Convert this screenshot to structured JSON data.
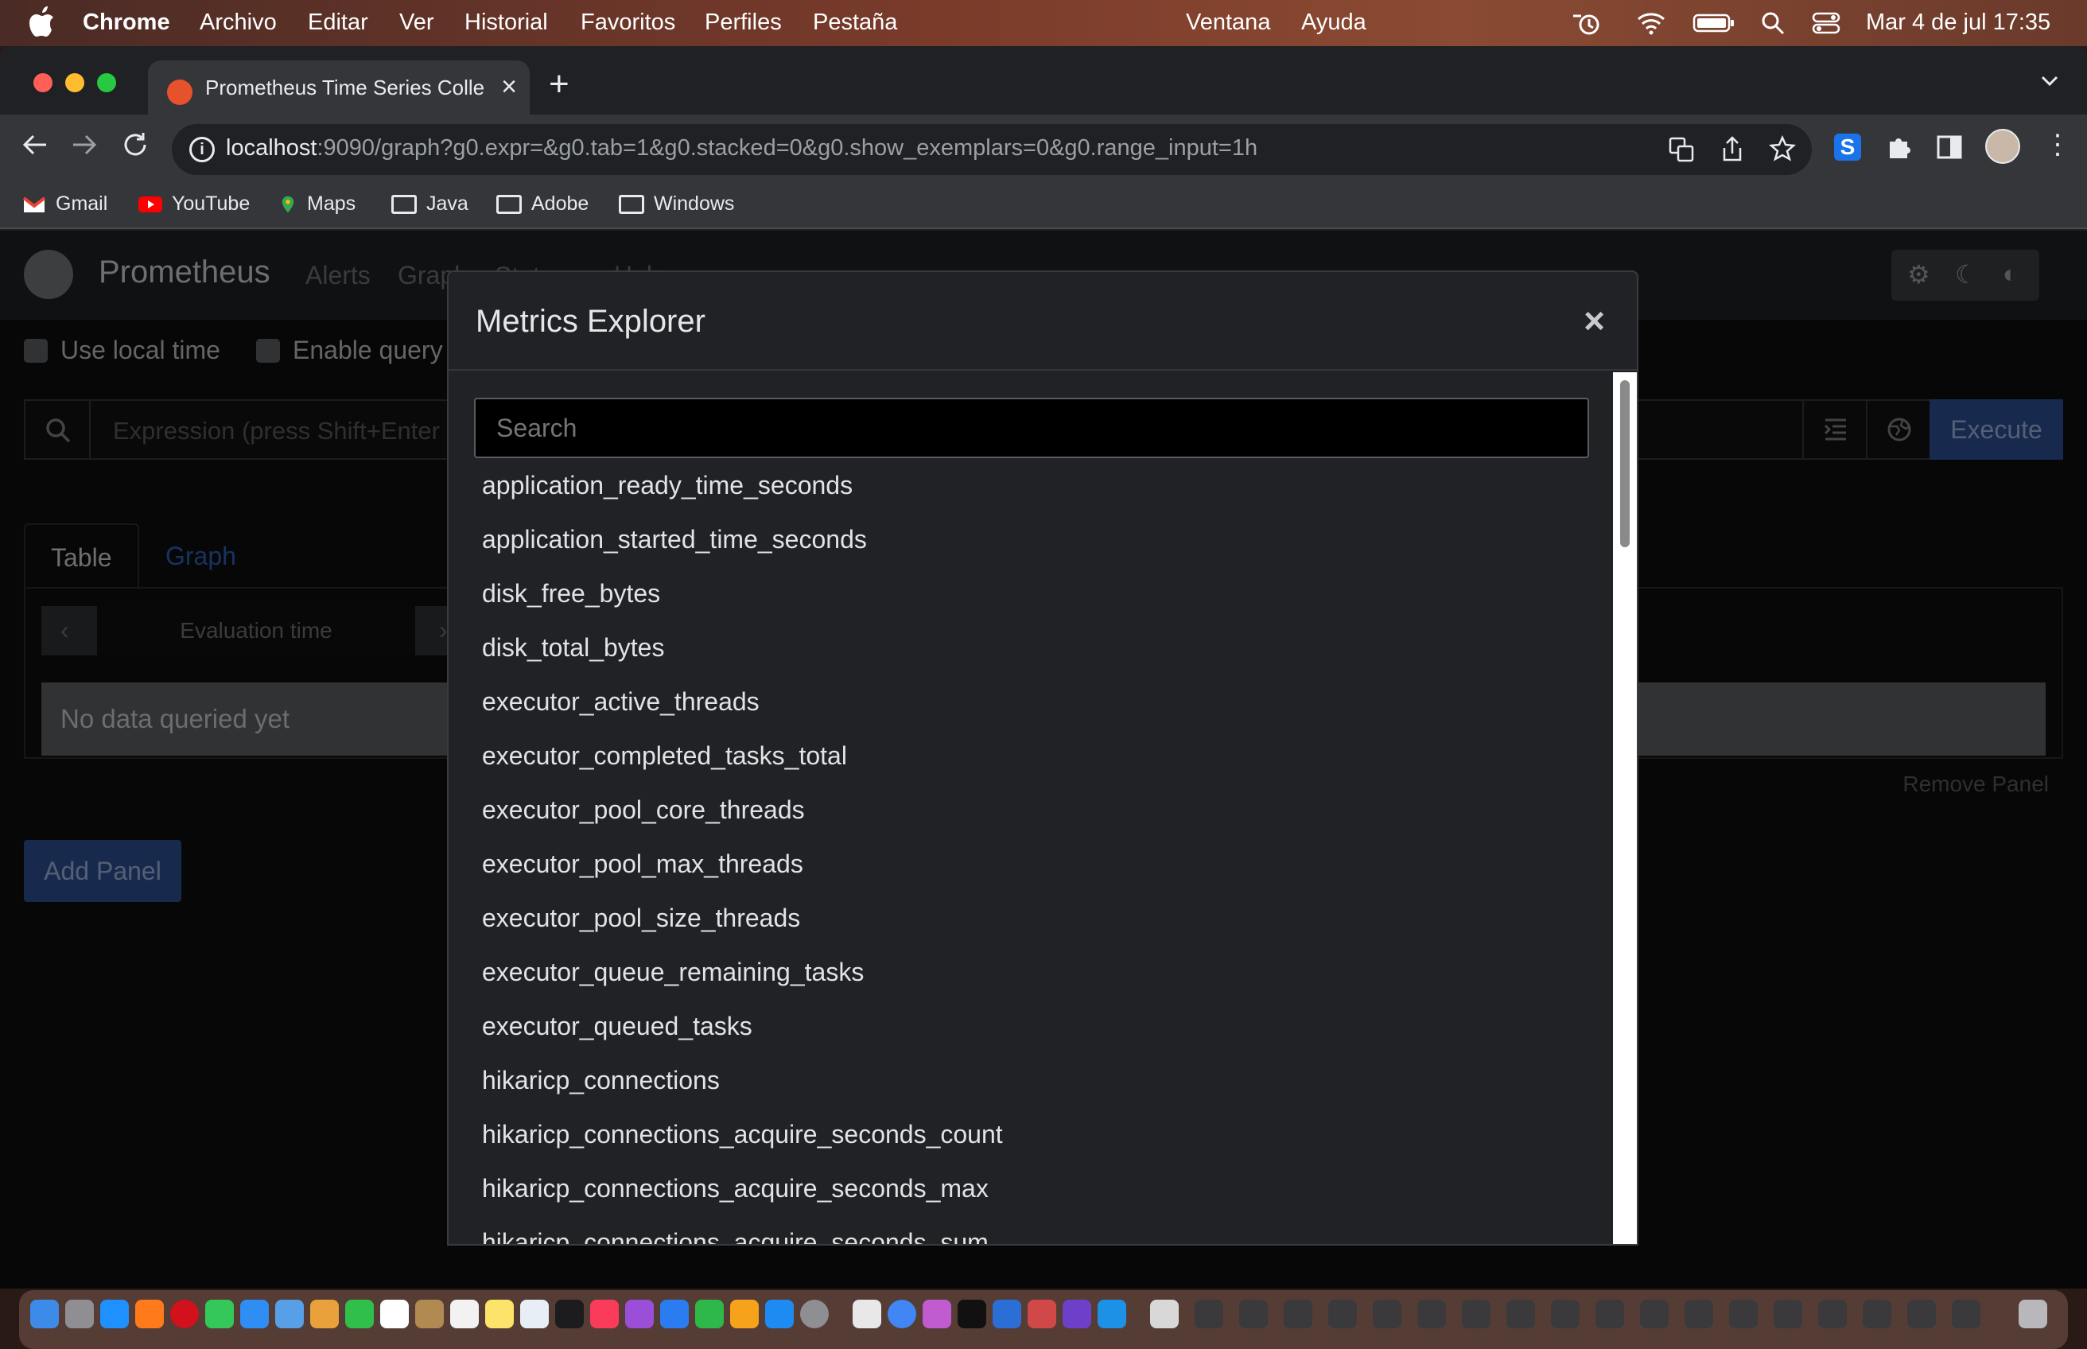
{
  "menubar": {
    "app": "Chrome",
    "items": [
      "Archivo",
      "Editar",
      "Ver",
      "Historial",
      "Favoritos",
      "Perfiles",
      "Pestaña",
      "Ventana",
      "Ayuda"
    ],
    "datetime": "Mar 4 de jul  17:35"
  },
  "browser": {
    "tab_title": "Prometheus Time Series Collec",
    "url_host": "localhost",
    "url_rest": ":9090/graph?g0.expr=&g0.tab=1&g0.stacked=0&g0.show_exemplars=0&g0.range_input=1h",
    "bookmarks": [
      "Gmail",
      "YouTube",
      "Maps",
      "Java",
      "Adobe",
      "Windows"
    ]
  },
  "prometheus": {
    "brand": "Prometheus",
    "nav": [
      "Alerts",
      "Graph",
      "Status ▾",
      "Help"
    ],
    "use_local_time": "Use local time",
    "enable_query": "Enable query",
    "expression_placeholder": "Expression (press Shift+Enter f",
    "execute": "Execute",
    "tab_table": "Table",
    "tab_graph": "Graph",
    "evaluation_time": "Evaluation time",
    "no_data": "No data queried yet",
    "remove_panel": "Remove Panel",
    "add_panel": "Add Panel"
  },
  "modal": {
    "title": "Metrics Explorer",
    "close": "×",
    "search_placeholder": "Search",
    "metrics": [
      "application_ready_time_seconds",
      "application_started_time_seconds",
      "disk_free_bytes",
      "disk_total_bytes",
      "executor_active_threads",
      "executor_completed_tasks_total",
      "executor_pool_core_threads",
      "executor_pool_max_threads",
      "executor_pool_size_threads",
      "executor_queue_remaining_tasks",
      "executor_queued_tasks",
      "hikaricp_connections",
      "hikaricp_connections_acquire_seconds_count",
      "hikaricp_connections_acquire_seconds_max",
      "hikaricp_connections_acquire_seconds_sum"
    ]
  },
  "colors": {
    "accent": "#2a4d8f",
    "prometheus_orange": "#e6522c"
  }
}
